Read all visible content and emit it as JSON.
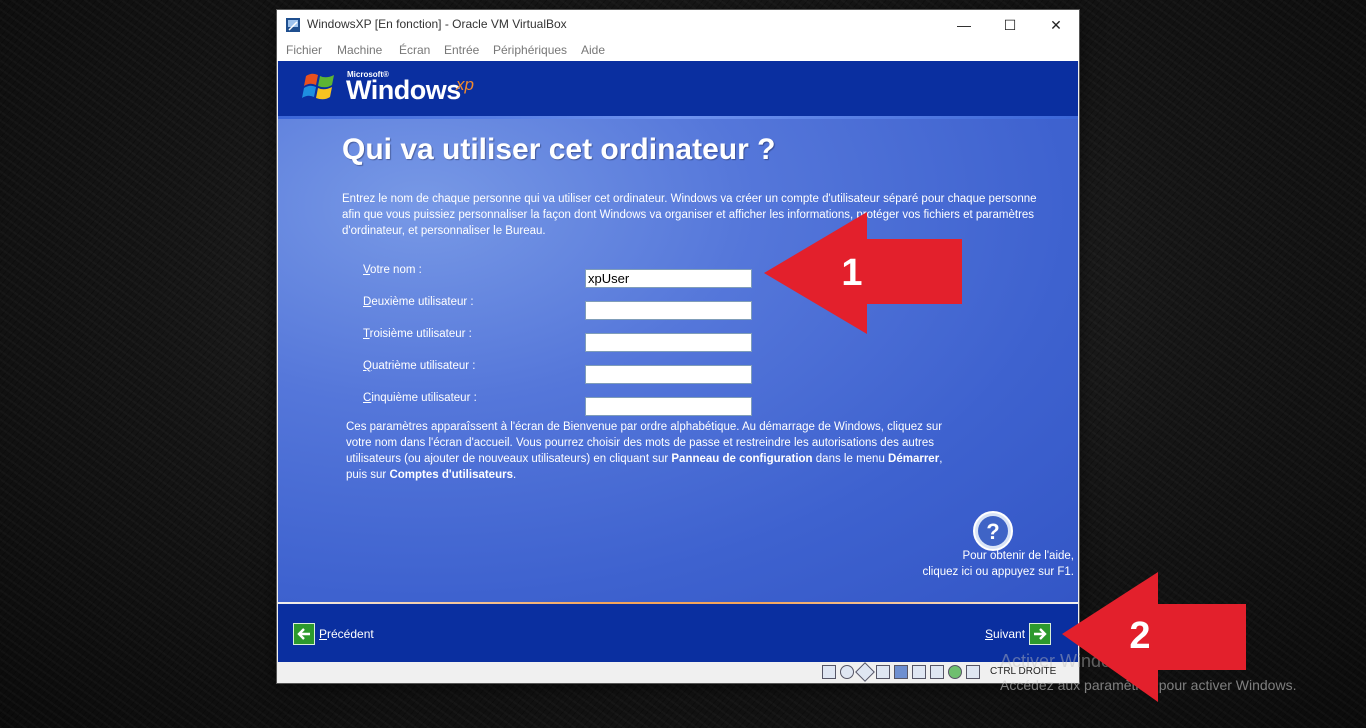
{
  "window": {
    "title": "WindowsXP [En fonction] - Oracle VM VirtualBox",
    "controls": [
      "—",
      "☐",
      "✕"
    ]
  },
  "menu": [
    "Fichier",
    "Machine",
    "Écran",
    "Entrée",
    "Périphériques",
    "Aide"
  ],
  "xp": {
    "logo_microsoft": "Microsoft®",
    "logo_windows": "Windows",
    "logo_xp": "xp",
    "heading": "Qui va utiliser cet ordinateur ?",
    "intro": "Entrez le nom de chaque personne qui va utiliser cet ordinateur. Windows va créer un compte d'utilisateur séparé pour chaque personne afin que vous puissiez personnaliser la façon dont Windows va organiser et afficher les informations, protéger vos fichiers et paramètres d'ordinateur, et personnaliser le Bureau.",
    "fields": [
      {
        "label_first": "V",
        "label_rest": "otre nom :",
        "value": "xpUser"
      },
      {
        "label_first": "D",
        "label_rest": "euxième utilisateur :",
        "value": ""
      },
      {
        "label_first": "T",
        "label_rest": "roisième utilisateur :",
        "value": ""
      },
      {
        "label_first": "Q",
        "label_rest": "uatrième utilisateur :",
        "value": ""
      },
      {
        "label_first": "C",
        "label_rest": "inquième utilisateur :",
        "value": ""
      }
    ],
    "note_part1": "Ces paramètres apparaîssent à l'écran de Bienvenue par ordre alphabétique. Au démarrage de Windows, cliquez sur votre nom dans l'écran d'accueil. Vous pourrez choisir des mots de passe et restreindre les autorisations des autres utilisateurs (ou ajouter de nouveaux utilisateurs) en cliquant sur ",
    "note_bold1": "Panneau de configuration",
    "note_part2": " dans le menu ",
    "note_bold2": "Démarrer",
    "note_part3": ", puis sur ",
    "note_bold3": "Comptes d'utilisateurs",
    "note_part4": ".",
    "help_line1": "Pour obtenir de l'aide,",
    "help_line2": "cliquez ici ou appuyez sur F1.",
    "back_first": "P",
    "back_rest": "récédent",
    "next_first": "S",
    "next_rest": "uivant"
  },
  "statusbar": {
    "host_key": "CTRL DROITE"
  },
  "watermark": {
    "line1": "Activer Windows",
    "line2": "Accédez aux paramètres pour activer Windows."
  },
  "annotations": {
    "arrow1_number": "1",
    "arrow2_number": "2"
  },
  "colors": {
    "xp_dark_blue": "#0a2fa0",
    "xp_panel_blue": "#5577da",
    "annotation_red": "#e3202c",
    "xp_logo_orange": "#f08a2e"
  }
}
